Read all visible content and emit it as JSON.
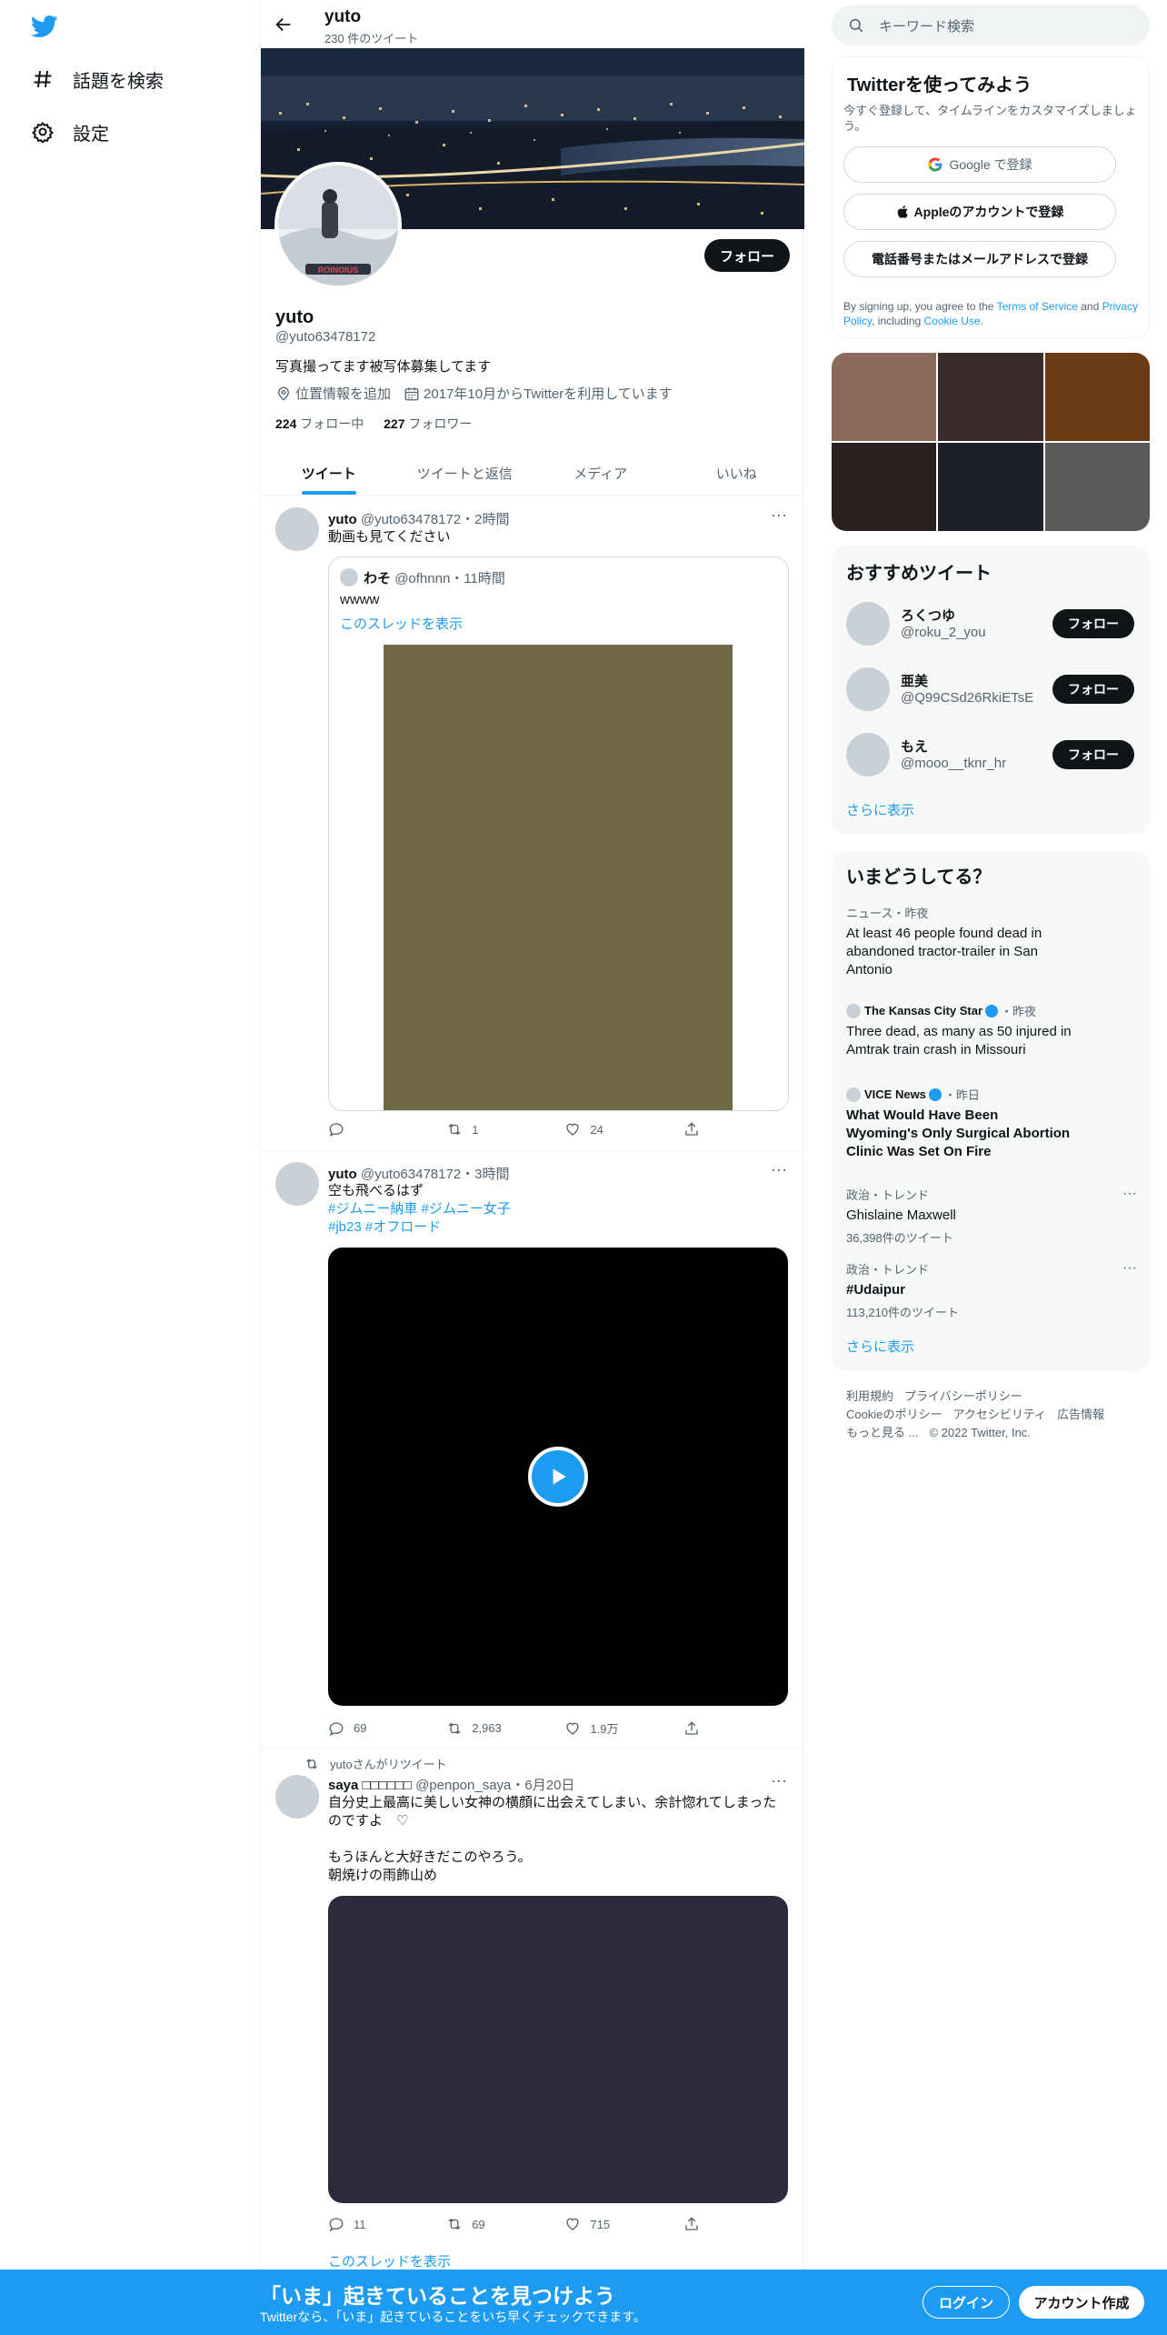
{
  "nav": {
    "explore": "話題を検索",
    "settings": "設定"
  },
  "profile_header": {
    "name": "yuto",
    "tweet_count": "230 件のツイート"
  },
  "profile": {
    "name": "yuto",
    "handle": "@yuto63478172",
    "bio": "写真撮ってます被写体募集してます",
    "location": "位置情報を追加",
    "joined": "2017年10月からTwitterを利用しています",
    "following_count": "224",
    "following_label": "フォロー中",
    "followers_count": "227",
    "followers_label": "フォロワー",
    "follow_button": "フォロー",
    "avatar_text": "ROINOIUS"
  },
  "tabs": [
    "ツイート",
    "ツイートと返信",
    "メディア",
    "いいね"
  ],
  "tweets": [
    {
      "name": "yuto",
      "handle": "@yuto63478172",
      "time": "・2時間",
      "text": "動画も見てください",
      "quote": {
        "name": "わそ",
        "handle": "@ofhnnn",
        "time": "・11時間",
        "text": "wwww",
        "link": "このスレッドを表示"
      },
      "reply": "",
      "retweet": "1",
      "like": "24"
    },
    {
      "name": "yuto",
      "handle": "@yuto63478172",
      "time": "・3時間",
      "text": "空も飛べるはず",
      "tags1": "#ジムニー納車 #ジムニー女子",
      "tags2": "#jb23 #オフロード",
      "reply": "69",
      "retweet": "2,963",
      "like": "1.9万"
    },
    {
      "retweeted_by": "yutoさんがリツイート",
      "name": "saya □□□□□□",
      "handle": "@penpon_saya",
      "time": "・6月20日",
      "text1": "自分史上最高に美しい女神の横顔に出会えてしまい、余計惚れてしまったのですよ　♡",
      "text2": "もうほんと大好きだこのやろう。",
      "text3": "朝焼けの雨飾山め",
      "reply": "11",
      "retweet": "69",
      "like": "715",
      "thread_link": "このスレッドを表示"
    }
  ],
  "sidebar": {
    "search_placeholder": "キーワード検索",
    "signup": {
      "title": "Twitterを使ってみよう",
      "subtitle": "今すぐ登録して、タイムラインをカスタマイズしましょう。",
      "google": "Google で登録",
      "apple": "Appleのアカウントで登録",
      "phone": "電話番号またはメールアドレスで登録",
      "legal_1": "By signing up, you agree to the ",
      "tos": "Terms of Service",
      "legal_2": " and ",
      "privacy": "Privacy Policy",
      "legal_3": ", including ",
      "cookie": "Cookie Use",
      "legal_4": "."
    },
    "recommend": {
      "title": "おすすめツイート",
      "users": [
        {
          "name": "ろくつゆ",
          "handle": "@roku_2_you",
          "button": "フォロー"
        },
        {
          "name": "亜美",
          "handle": "@Q99CSd26RkiETsE",
          "button": "フォロー"
        },
        {
          "name": "もえ",
          "handle": "@mooo__tknr_hr",
          "button": "フォロー"
        }
      ],
      "more": "さらに表示"
    },
    "trends": {
      "title": "いまどうしてる？",
      "items": [
        {
          "meta": "ニュース・昨夜",
          "title": "At least 46 people found dead in abandoned tractor-trailer in San Antonio"
        },
        {
          "source": "The Kansas City Star",
          "meta": "・昨夜",
          "title": "Three dead, as many as 50 injured in Amtrak train crash in Missouri"
        },
        {
          "source": "VICE News",
          "meta": "・昨日",
          "title": "What Would Have Been Wyoming's Only Surgical Abortion Clinic Was Set On Fire"
        },
        {
          "meta": "政治・トレンド",
          "title": "Ghislaine Maxwell",
          "count": "36,398件のツイート"
        },
        {
          "meta": "政治・トレンド",
          "title": "#Udaipur",
          "count": "113,210件のツイート"
        }
      ],
      "more": "さらに表示"
    },
    "footer": {
      "terms": "利用規約",
      "privacy": "プライバシーポリシー",
      "cookie": "Cookieのポリシー",
      "accessibility": "アクセシビリティ",
      "ads": "広告情報",
      "more": "もっと見る ...",
      "copyright": "© 2022 Twitter, Inc."
    }
  },
  "bottom_bar": {
    "title": "「いま」起きていることを見つけよう",
    "subtitle": "Twitterなら、「いま」起きていることをいち早くチェックできます。",
    "login": "ログイン",
    "signup": "アカウント作成"
  },
  "colors": {
    "accent": "#1d9bf0",
    "text": "#0f1419",
    "muted": "#536471"
  }
}
